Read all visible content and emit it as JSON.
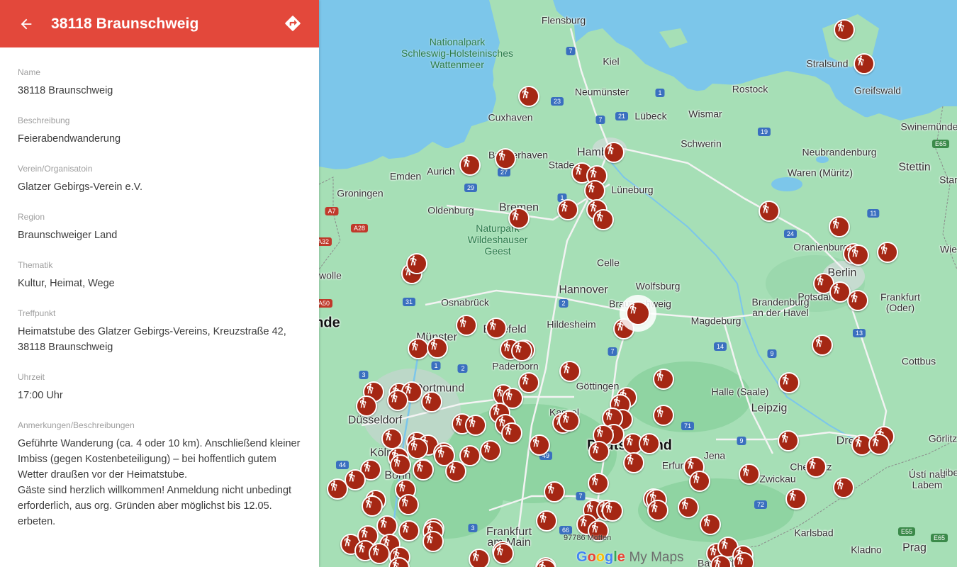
{
  "panel": {
    "title": "38118 Braunschweig",
    "fields": [
      {
        "label": "Name",
        "value": "38118 Braunschweig"
      },
      {
        "label": "Beschreibung",
        "value": "Feierabendwanderung"
      },
      {
        "label": "Verein/Organisatoin",
        "value": "Glatzer Gebirgs-Verein e.V."
      },
      {
        "label": "Region",
        "value": "Braunschweiger Land"
      },
      {
        "label": "Thematik",
        "value": "Kultur, Heimat, Wege"
      },
      {
        "label": "Treffpunkt",
        "value": "Heimatstube des Glatzer Gebirgs-Vereins, Kreuzstraße 42,\n38118 Braunschweig"
      },
      {
        "label": "Uhrzeit",
        "value": "17:00 Uhr"
      },
      {
        "label": "Anmerkungen/Beschreibungen",
        "value": "Geführte Wanderung (ca. 4 oder 10 km). Anschließend kleiner\nImbiss (gegen Kostenbeteiligung) – bei hoffentlich gutem\nWetter draußen vor der Heimatstube.\nGäste sind herzlich willkommen! Anmeldung nicht unbedingt\nerforderlich, aus org. Gründen aber möglichst bis 12.05.\nerbeten."
      }
    ],
    "icons": {
      "back": "arrow-back-icon",
      "directions": "directions-icon"
    }
  },
  "map": {
    "colors": {
      "land": "#a6dfb6",
      "sea": "#7cc6ea",
      "header": "#e3483b",
      "pin": "#a52714"
    },
    "marker_icon": "hiking-icon",
    "places": {
      "flensburg": "Flensburg",
      "kiel": "Kiel",
      "neumuenster": "Neumünster",
      "luebeck": "Lübeck",
      "wismar": "Wismar",
      "rostock": "Rostock",
      "stralsund": "Stralsund",
      "greifswald": "Greifswald",
      "swinemuende": "Swinemünde",
      "cuxhaven": "Cuxhaven",
      "bremerhaven": "Bremerhaven",
      "hamburg": "Hamburg",
      "stade": "Stade",
      "schwerin": "Schwerin",
      "neubrandenburg": "Neubrandenburg",
      "stettin": "Stettin",
      "aurich": "Aurich",
      "emden": "Emden",
      "groningen": "Groningen",
      "oldenburg": "Oldenburg",
      "bremen": "Bremen",
      "lueneburg": "Lüneburg",
      "waren": "Waren (Müritz)",
      "oranienburg": "Oranienburg",
      "celle": "Celle",
      "hannover": "Hannover",
      "wolfsburg": "Wolfsburg",
      "braunschweig": "Braunschweig",
      "berlin": "Berlin",
      "potsdam": "Potsdam",
      "osnabrueck": "Osnabrück",
      "bielefeld": "Bielefeld",
      "muenster": "Münster",
      "hildesheim": "Hildesheim",
      "magdeburg": "Magdeburg",
      "brandenburg": "Brandenburg\nan der Havel",
      "frankfurt_oder": "Frankfurt\n(Oder)",
      "paderborn": "Paderborn",
      "cottbus": "Cottbus",
      "goettingen": "Göttingen",
      "halle": "Halle (Saale)",
      "dortmund": "Dortmund",
      "duesseldorf": "Düsseldorf",
      "leipzig": "Leipzig",
      "kassel": "Kassel",
      "deutschland": "Deutschland",
      "jena": "Jena",
      "erfurt": "Erfurt",
      "dresden": "Dresden",
      "goerlitz": "Görlitz",
      "koeln": "Köln",
      "bonn": "Bonn",
      "chemnitz": "Chemnitz",
      "zwickau": "Zwickau",
      "usti": "Ústí nad\nLabem",
      "frankfurt": "Frankfurt\nam Main",
      "karlsbad": "Karlsbad",
      "kladno": "Kladno",
      "prag": "Prag",
      "bayreuth": "Bayreuth",
      "zwolle": "wolle",
      "nde": "nde",
      "wie": "Wie",
      "star": "Star",
      "libe": "Libe"
    },
    "parks": {
      "wattenmeer": "Nationalpark\nSchleswig-Holsteinisches\nWattenmeer",
      "wildeshauser": "Naturpark\nWildeshauser\nGeest"
    },
    "roads": [
      "7",
      "1",
      "23",
      "7",
      "21",
      "19",
      "E65",
      "27",
      "29",
      "1",
      "A7",
      "A28",
      "A32",
      "24",
      "11",
      "31",
      "2",
      "2",
      "7",
      "14",
      "9",
      "13",
      "A50",
      "3",
      "1",
      "2",
      "71",
      "9",
      "44",
      "49",
      "7",
      "72",
      "66",
      "3",
      "E55",
      "E65"
    ],
    "scale": "97786 Motten",
    "attribution": {
      "google": "Google",
      "mymaps": "My Maps"
    }
  }
}
